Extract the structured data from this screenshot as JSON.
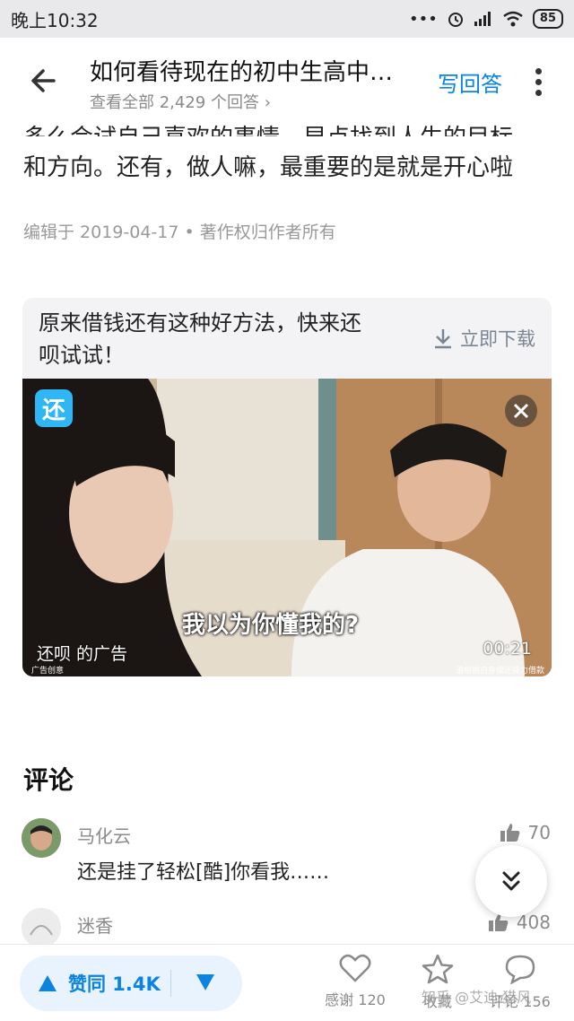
{
  "status_bar": {
    "time": "晚上10:32",
    "battery": "85"
  },
  "header": {
    "title": "如何看待现在的初中生高中…",
    "subtitle": "查看全部 2,429 个回答 ›",
    "write_answer": "写回答"
  },
  "answer": {
    "cut_line": "多么会试自己喜欢的事情，早点找到人生的目标",
    "last_line": "和方向。还有，做人嘛，最重要的是就是开心啦",
    "meta": "编辑于 2019-04-17 • 著作权归作者所有"
  },
  "ad": {
    "title": "原来借钱还有这种好方法，快来还呗试试！",
    "download": "立即下载",
    "app_logo": "还",
    "video_subtitle": "我以为你懂我的?",
    "sponsor": "还呗 的广告",
    "sponsor_small": "广告创意",
    "duration": "00:21",
    "disclaimer": "请根据自身偿还能力借款"
  },
  "comments": {
    "title": "评论",
    "items": [
      {
        "name": "马化云",
        "text": "还是挂了轻松[酷]你看我……",
        "likes": "70"
      },
      {
        "name": "迷香",
        "text": "",
        "likes": "408"
      }
    ]
  },
  "bottom_bar": {
    "vote_up": "赞同 1.4K",
    "thanks": "感谢 120",
    "favorite": "收藏",
    "comment": "评论 156"
  },
  "watermark": "知乎 @艾迪·猎风"
}
